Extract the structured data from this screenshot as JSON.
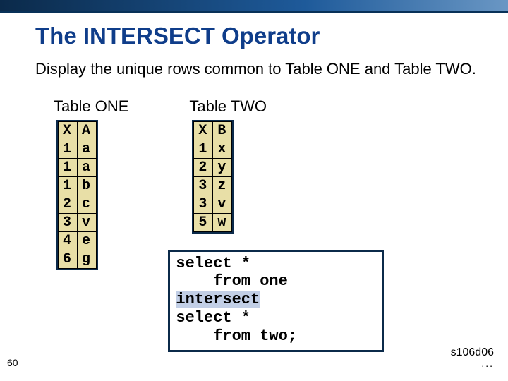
{
  "title": "The INTERSECT Operator",
  "description": "Display the unique rows common to Table ONE and Table TWO.",
  "tableOne": {
    "caption": "Table ONE",
    "headers": [
      "X",
      "A"
    ],
    "rows": [
      [
        "1",
        "a"
      ],
      [
        "1",
        "a"
      ],
      [
        "1",
        "b"
      ],
      [
        "2",
        "c"
      ],
      [
        "3",
        "v"
      ],
      [
        "4",
        "e"
      ],
      [
        "6",
        "g"
      ]
    ]
  },
  "tableTwo": {
    "caption": "Table TWO",
    "headers": [
      "X",
      "B"
    ],
    "rows": [
      [
        "1",
        "x"
      ],
      [
        "2",
        "y"
      ],
      [
        "3",
        "z"
      ],
      [
        "3",
        "v"
      ],
      [
        "5",
        "w"
      ]
    ]
  },
  "sql": {
    "line1": "select *",
    "line2": "    from one",
    "keyword": "intersect",
    "line4": "select *",
    "line5": "    from two;"
  },
  "pageNumber": "60",
  "footerCode": "s106d06",
  "footerDots": "..."
}
